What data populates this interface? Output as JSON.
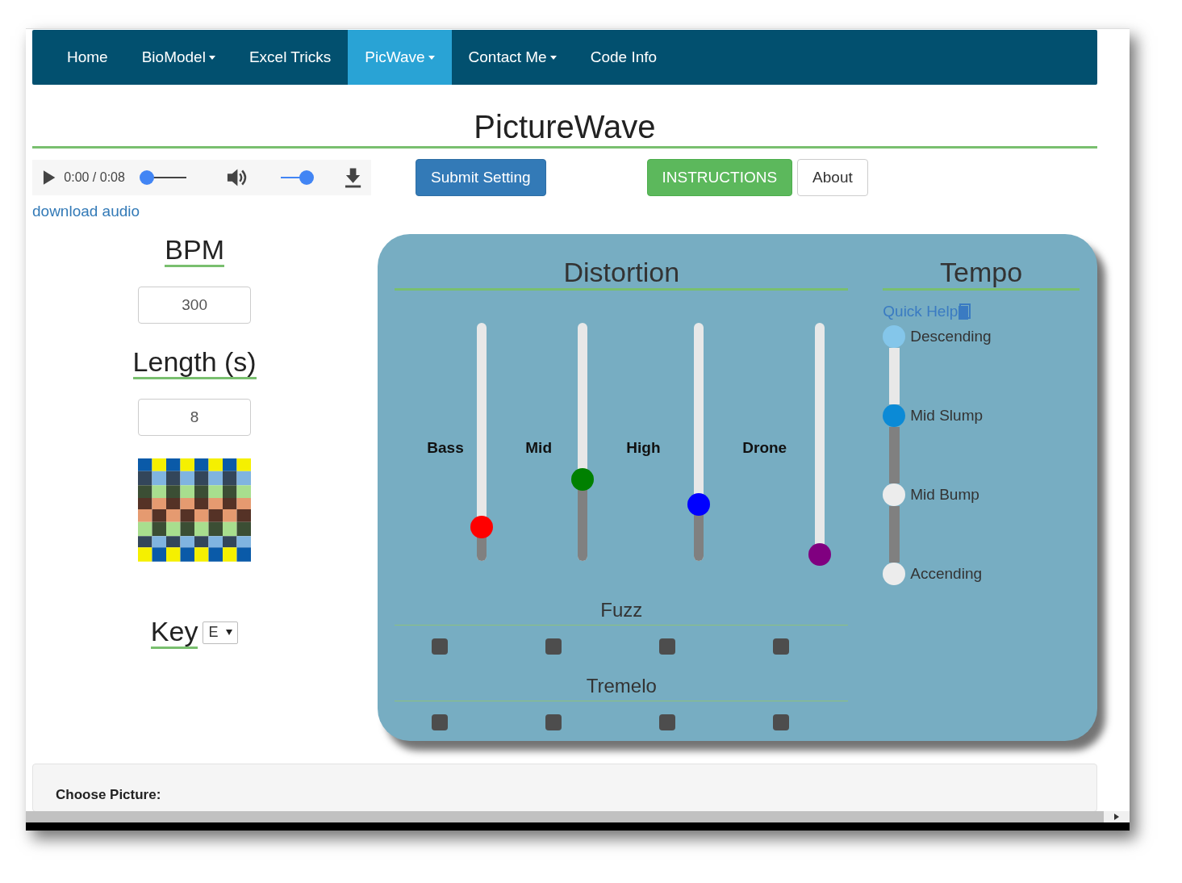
{
  "nav": {
    "items": [
      {
        "label": "Home",
        "dropdown": false,
        "selected": false
      },
      {
        "label": "BioModel",
        "dropdown": true,
        "selected": false
      },
      {
        "label": "Excel Tricks",
        "dropdown": false,
        "selected": false
      },
      {
        "label": "PicWave",
        "dropdown": true,
        "selected": true
      },
      {
        "label": "Contact Me",
        "dropdown": true,
        "selected": false
      },
      {
        "label": "Code Info",
        "dropdown": false,
        "selected": false
      }
    ]
  },
  "title": "PictureWave",
  "player": {
    "time": "0:00 / 0:08",
    "progress": {
      "level": 0
    },
    "volume": {
      "level": 1
    }
  },
  "download_link": "download audio",
  "buttons": [
    {
      "label": "Submit Setting",
      "kind": "primary"
    },
    {
      "label": "INSTRUCTIONS",
      "kind": "success"
    },
    {
      "label": "About",
      "kind": "default"
    }
  ],
  "bpm": {
    "label": "BPM",
    "value": "300"
  },
  "length": {
    "label": "Length (s)",
    "value": "8"
  },
  "key": {
    "label": "Key",
    "value": "E"
  },
  "distortion": {
    "title": "Distortion",
    "sliders": [
      {
        "label": "Bass",
        "level": 0.15,
        "color": "#ff0000"
      },
      {
        "label": "Mid",
        "level": 0.36,
        "color": "#008000"
      },
      {
        "label": "High",
        "level": 0.25,
        "color": "#0000ff"
      },
      {
        "label": "Drone",
        "level": 0.03,
        "color": "#800080"
      }
    ],
    "fuzz": {
      "title": "Fuzz",
      "checks": [
        {
          "checked": false
        },
        {
          "checked": false
        },
        {
          "checked": false
        },
        {
          "checked": false
        }
      ]
    },
    "tremelo": {
      "title": "Tremelo",
      "checks": [
        {
          "checked": false
        },
        {
          "checked": false
        },
        {
          "checked": false
        },
        {
          "checked": false
        }
      ]
    }
  },
  "tempo": {
    "title": "Tempo",
    "help": "Quick Help",
    "options": [
      {
        "label": "Descending",
        "selected": false
      },
      {
        "label": "Mid Slump",
        "selected": true
      },
      {
        "label": "Mid Bump",
        "selected": false
      },
      {
        "label": "Accending",
        "selected": false
      }
    ]
  },
  "picture_panel": {
    "label": "Choose Picture:"
  }
}
